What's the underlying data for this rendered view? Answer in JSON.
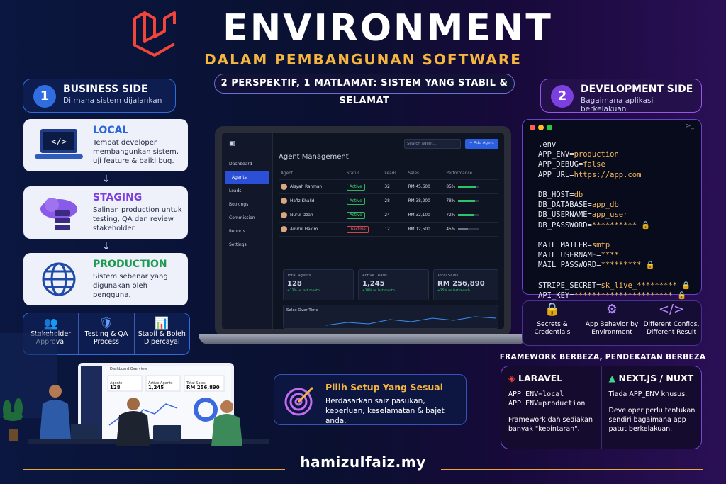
{
  "header": {
    "title": "ENVIRONMENT",
    "subtitle": "DALAM PEMBANGUNAN SOFTWARE",
    "tagline": "2 PERSPEKTIF, 1 MATLAMAT: SISTEM YANG STABIL & SELAMAT"
  },
  "business": {
    "num": "1",
    "title": "BUSINESS SIDE",
    "sub": "Di mana sistem dijalankan",
    "envs": [
      {
        "name": "LOCAL",
        "desc": "Tempat developer membangunkan sistem, uji feature & baiki bug.",
        "color": "#2b67d8"
      },
      {
        "name": "STAGING",
        "desc": "Salinan production untuk testing, QA dan review stakeholder.",
        "color": "#7b3fe0"
      },
      {
        "name": "PRODUCTION",
        "desc": "Sistem sebenar yang digunakan oleh pengguna.",
        "color": "#1c9a50"
      }
    ],
    "features": [
      "Stakeholder Approval",
      "Testing & QA Process",
      "Stabil & Boleh Dipercayai"
    ]
  },
  "development": {
    "num": "2",
    "title": "DEVELOPMENT SIDE",
    "sub": "Bagaimana aplikasi berkelakuan",
    "file": ".env",
    "lines": [
      [
        "APP_ENV=",
        "production"
      ],
      [
        "APP_DEBUG=",
        "false"
      ],
      [
        "APP_URL=",
        "https://app.com"
      ],
      [
        "",
        ""
      ],
      [
        "DB_HOST=",
        "db"
      ],
      [
        "DB_DATABASE=",
        "app_db"
      ],
      [
        "DB_USERNAME=",
        "app_user"
      ],
      [
        "DB_PASSWORD=",
        "**********"
      ],
      [
        "",
        ""
      ],
      [
        "MAIL_MAILER=",
        "smtp"
      ],
      [
        "MAIL_USERNAME=",
        "****"
      ],
      [
        "MAIL_PASSWORD=",
        "*********"
      ],
      [
        "",
        ""
      ],
      [
        "STRIPE_SECRET=",
        "sk_live_*********"
      ],
      [
        "API_KEY=",
        "**********************"
      ]
    ],
    "trio": [
      "Secrets & Credentials",
      "App Behavior by Environment",
      "Different Configs, Different Result"
    ]
  },
  "framework": {
    "title": "FRAMEWORK BERBEZA, PENDEKATAN BERBEZA",
    "laravel": {
      "name": "LARAVEL",
      "code1": "APP_ENV=local",
      "code2": "APP_ENV=production",
      "desc": "Framework dah sediakan banyak \"kepintaran\"."
    },
    "next": {
      "name": "NEXT.JS / NUXT",
      "l1": "Tiada APP_ENV khusus.",
      "desc": "Developer perlu tentukan sendiri bagaimana app patut berkelakuan."
    }
  },
  "setup": {
    "title": "Pilih Setup Yang Sesuai",
    "desc": "Berdasarkan saiz pasukan, keperluan, keselamatan & bajet anda."
  },
  "footer": "hamizulfaiz.my",
  "dashboard": {
    "title": "Agent Management",
    "search": "Search agent...",
    "add": "+ Add Agent",
    "nav": [
      "Dashboard",
      "Agents",
      "Leads",
      "Bookings",
      "Commission",
      "Reports",
      "Settings"
    ],
    "cols": [
      "Agent",
      "Status",
      "Leads",
      "Sales",
      "Performance"
    ],
    "rows": [
      {
        "name": "Aisyah Rahman",
        "status": "Active",
        "leads": "32",
        "sales": "RM 45,600",
        "perf": "85%",
        "p": 0.85
      },
      {
        "name": "Hafiz Khalid",
        "status": "Active",
        "leads": "28",
        "sales": "RM 38,200",
        "perf": "78%",
        "p": 0.78
      },
      {
        "name": "Nurul Izzah",
        "status": "Active",
        "leads": "24",
        "sales": "RM 32,100",
        "perf": "72%",
        "p": 0.72
      },
      {
        "name": "Amirul Hakim",
        "status": "Inactive",
        "leads": "12",
        "sales": "RM 12,500",
        "perf": "45%",
        "p": 0.45
      }
    ],
    "kpis": [
      {
        "l": "Total Agents",
        "v": "128",
        "c": "+12% vs last month"
      },
      {
        "l": "Active Leads",
        "v": "1,245",
        "c": "+18% vs last month"
      },
      {
        "l": "Total Sales",
        "v": "RM 256,890",
        "c": "+25% vs last month"
      }
    ],
    "chart": "Sales Over Time"
  },
  "mini": {
    "title": "Dashboard Overview",
    "k1": "Agents",
    "v1": "128",
    "k2": "Active Agents",
    "v2": "1,245",
    "k3": "Total Sales",
    "v3": "RM 256,890"
  }
}
